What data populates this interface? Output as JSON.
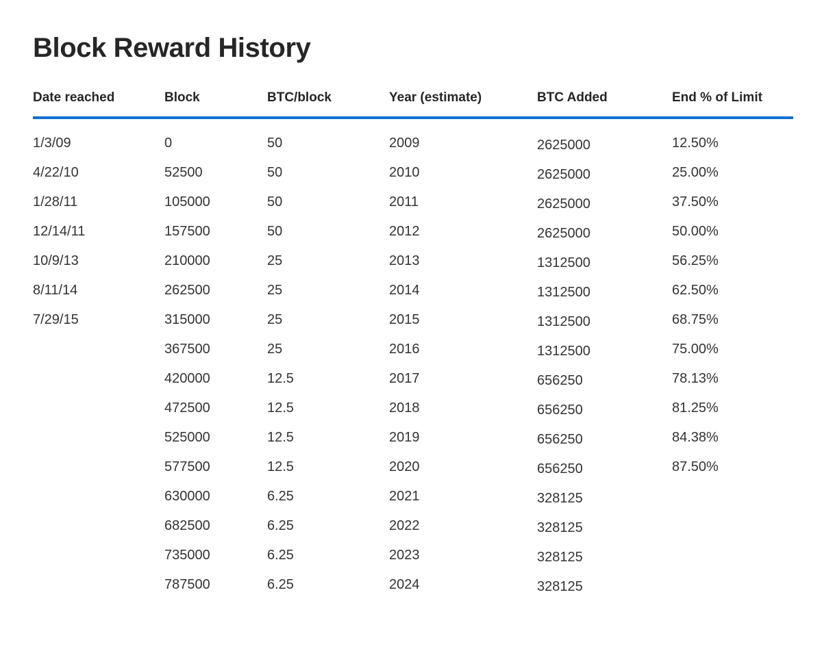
{
  "title": "Block Reward History",
  "accent_color": "#1070d0",
  "header_text_color": "#262626",
  "body_text_color": "#333333",
  "background_color": "#ffffff",
  "table": {
    "columns": [
      "Date reached",
      "Block",
      "BTC/block",
      "Year (estimate)",
      "BTC Added",
      "End % of Limit"
    ],
    "rows": [
      {
        "date": "1/3/09",
        "block": "0",
        "btc_per_block": "50",
        "year": "2009",
        "btc_added": "2625000",
        "end_pct": "12.50%"
      },
      {
        "date": "4/22/10",
        "block": "52500",
        "btc_per_block": "50",
        "year": "2010",
        "btc_added": "2625000",
        "end_pct": "25.00%"
      },
      {
        "date": "1/28/11",
        "block": "105000",
        "btc_per_block": "50",
        "year": "2011",
        "btc_added": "2625000",
        "end_pct": "37.50%"
      },
      {
        "date": "12/14/11",
        "block": "157500",
        "btc_per_block": "50",
        "year": "2012",
        "btc_added": "2625000",
        "end_pct": "50.00%"
      },
      {
        "date": "10/9/13",
        "block": "210000",
        "btc_per_block": "25",
        "year": "2013",
        "btc_added": "1312500",
        "end_pct": "56.25%"
      },
      {
        "date": "8/11/14",
        "block": "262500",
        "btc_per_block": "25",
        "year": "2014",
        "btc_added": "1312500",
        "end_pct": "62.50%"
      },
      {
        "date": "7/29/15",
        "block": "315000",
        "btc_per_block": "25",
        "year": "2015",
        "btc_added": "1312500",
        "end_pct": "68.75%"
      },
      {
        "date": "",
        "block": "367500",
        "btc_per_block": "25",
        "year": "2016",
        "btc_added": "1312500",
        "end_pct": "75.00%"
      },
      {
        "date": "",
        "block": "420000",
        "btc_per_block": "12.5",
        "year": "2017",
        "btc_added": "656250",
        "end_pct": "78.13%"
      },
      {
        "date": "",
        "block": "472500",
        "btc_per_block": "12.5",
        "year": "2018",
        "btc_added": "656250",
        "end_pct": "81.25%"
      },
      {
        "date": "",
        "block": "525000",
        "btc_per_block": "12.5",
        "year": "2019",
        "btc_added": "656250",
        "end_pct": "84.38%"
      },
      {
        "date": "",
        "block": "577500",
        "btc_per_block": "12.5",
        "year": "2020",
        "btc_added": "656250",
        "end_pct": "87.50%"
      },
      {
        "date": "",
        "block": "630000",
        "btc_per_block": "6.25",
        "year": "2021",
        "btc_added": "328125",
        "end_pct": ""
      },
      {
        "date": "",
        "block": "682500",
        "btc_per_block": "6.25",
        "year": "2022",
        "btc_added": "328125",
        "end_pct": ""
      },
      {
        "date": "",
        "block": "735000",
        "btc_per_block": "6.25",
        "year": "2023",
        "btc_added": "328125",
        "end_pct": ""
      },
      {
        "date": "",
        "block": "787500",
        "btc_per_block": "6.25",
        "year": "2024",
        "btc_added": "328125",
        "end_pct": ""
      }
    ]
  }
}
